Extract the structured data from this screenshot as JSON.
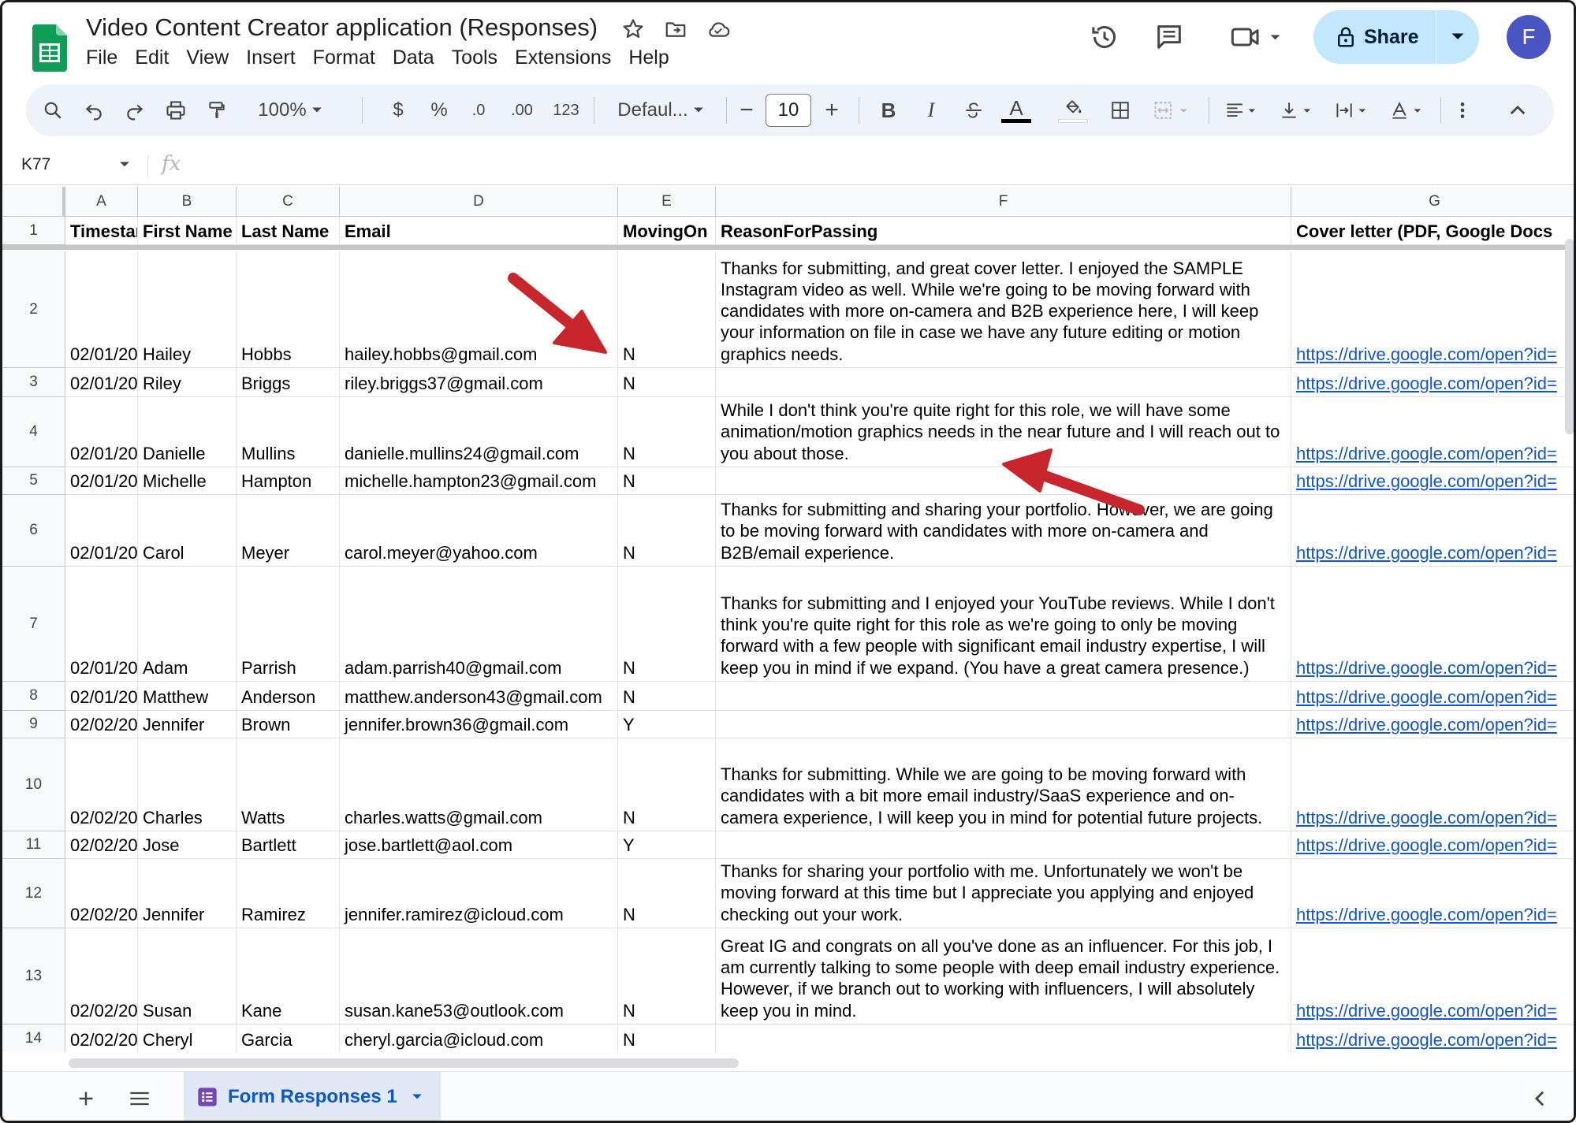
{
  "app": {
    "doc_title": "Video Content Creator application (Responses)",
    "menu": [
      "File",
      "Edit",
      "View",
      "Insert",
      "Format",
      "Data",
      "Tools",
      "Extensions",
      "Help"
    ],
    "share_label": "Share",
    "avatar_letter": "F"
  },
  "toolbar": {
    "zoom": "100%",
    "currency": "$",
    "percent": "%",
    "dec_decrease": ".0",
    "dec_increase": ".00",
    "number_format": "123",
    "font": "Defaul...",
    "font_size": "10",
    "minus": "−",
    "plus": "+",
    "bold": "B",
    "italic": "I",
    "text_color": "A"
  },
  "formula_bar": {
    "cell_ref": "K77",
    "fx": "fx"
  },
  "grid": {
    "columns": [
      "A",
      "B",
      "C",
      "D",
      "E",
      "F",
      "G"
    ],
    "headers": [
      "Timestamp",
      "First Name",
      "Last Name",
      "Email",
      "MovingOn",
      "ReasonForPassing",
      "Cover letter (PDF, Google Docs"
    ],
    "rows": [
      {
        "num": "2",
        "a": "02/01/20",
        "b": "Hailey",
        "c": "Hobbs",
        "d": "hailey.hobbs@gmail.com",
        "e": "N",
        "f": "Thanks for submitting, and great cover letter. I enjoyed the SAMPLE Instagram video as well. While we're going to be moving forward with candidates with more on-camera and B2B experience here, I will keep your information on file in case we have any future editing or motion graphics needs.",
        "g": "https://drive.google.com/open?id="
      },
      {
        "num": "3",
        "a": "02/01/20",
        "b": "Riley",
        "c": "Briggs",
        "d": "riley.briggs37@gmail.com",
        "e": "N",
        "f": "",
        "g": "https://drive.google.com/open?id="
      },
      {
        "num": "4",
        "a": "02/01/20",
        "b": "Danielle",
        "c": "Mullins",
        "d": "danielle.mullins24@gmail.com",
        "e": "N",
        "f": "While I don't think you're quite right for this role, we will have some animation/motion graphics needs in the near future and I will reach out to you about those.",
        "g": "https://drive.google.com/open?id="
      },
      {
        "num": "5",
        "a": "02/01/20",
        "b": "Michelle",
        "c": "Hampton",
        "d": "michelle.hampton23@gmail.com",
        "e": "N",
        "f": "",
        "g": "https://drive.google.com/open?id="
      },
      {
        "num": "6",
        "a": "02/01/20",
        "b": "Carol",
        "c": "Meyer",
        "d": "carol.meyer@yahoo.com",
        "e": "N",
        "f": "Thanks for submitting and sharing your portfolio. However, we are going to be moving forward with candidates with more on-camera and B2B/email experience.",
        "g": "https://drive.google.com/open?id="
      },
      {
        "num": "7",
        "a": "02/01/20",
        "b": "Adam",
        "c": "Parrish",
        "d": "adam.parrish40@gmail.com",
        "e": "N",
        "f": "Thanks for submitting and I enjoyed your YouTube reviews. While I don't think you're quite right for this role as we're going to only be moving forward with a few people with significant email industry expertise, I will keep you in mind if we expand. (You have a great camera presence.)",
        "g": "https://drive.google.com/open?id="
      },
      {
        "num": "8",
        "a": "02/01/20",
        "b": "Matthew",
        "c": "Anderson",
        "d": "matthew.anderson43@gmail.com",
        "e": "N",
        "f": "",
        "g": "https://drive.google.com/open?id="
      },
      {
        "num": "9",
        "a": "02/02/20",
        "b": "Jennifer",
        "c": "Brown",
        "d": "jennifer.brown36@gmail.com",
        "e": "Y",
        "f": "",
        "g": "https://drive.google.com/open?id="
      },
      {
        "num": "10",
        "a": "02/02/20",
        "b": "Charles",
        "c": "Watts",
        "d": "charles.watts@gmail.com",
        "e": "N",
        "f": "Thanks for submitting. While we are going to be moving forward with candidates with a bit more email industry/SaaS experience and on-camera experience, I will keep you in mind for potential future projects.",
        "g": "https://drive.google.com/open?id="
      },
      {
        "num": "11",
        "a": "02/02/20",
        "b": "Jose",
        "c": "Bartlett",
        "d": "jose.bartlett@aol.com",
        "e": "Y",
        "f": "",
        "g": "https://drive.google.com/open?id="
      },
      {
        "num": "12",
        "a": "02/02/20",
        "b": "Jennifer",
        "c": "Ramirez",
        "d": "jennifer.ramirez@icloud.com",
        "e": "N",
        "f": "Thanks for sharing your portfolio with me. Unfortunately we won't be moving forward at this time but I appreciate you applying and enjoyed checking out your work.",
        "g": "https://drive.google.com/open?id="
      },
      {
        "num": "13",
        "a": "02/02/20",
        "b": "Susan",
        "c": "Kane",
        "d": "susan.kane53@outlook.com",
        "e": "N",
        "f": "Great IG and congrats on all you've done as an influencer. For this job, I am currently talking to some people with deep email industry experience. However, if we branch out to working with influencers, I will absolutely keep you in mind.",
        "g": "https://drive.google.com/open?id="
      },
      {
        "num": "14",
        "a": "02/02/20",
        "b": "Cheryl",
        "c": "Garcia",
        "d": "cheryl.garcia@icloud.com",
        "e": "N",
        "f": "",
        "g": "https://drive.google.com/open?id="
      }
    ]
  },
  "sheet_tab": {
    "label": "Form Responses 1"
  },
  "colors": {
    "annotation_arrow": "#c9252c",
    "share_bg": "#c2e7ff",
    "link": "#1155cc",
    "sheets_green": "#0f9d58"
  }
}
